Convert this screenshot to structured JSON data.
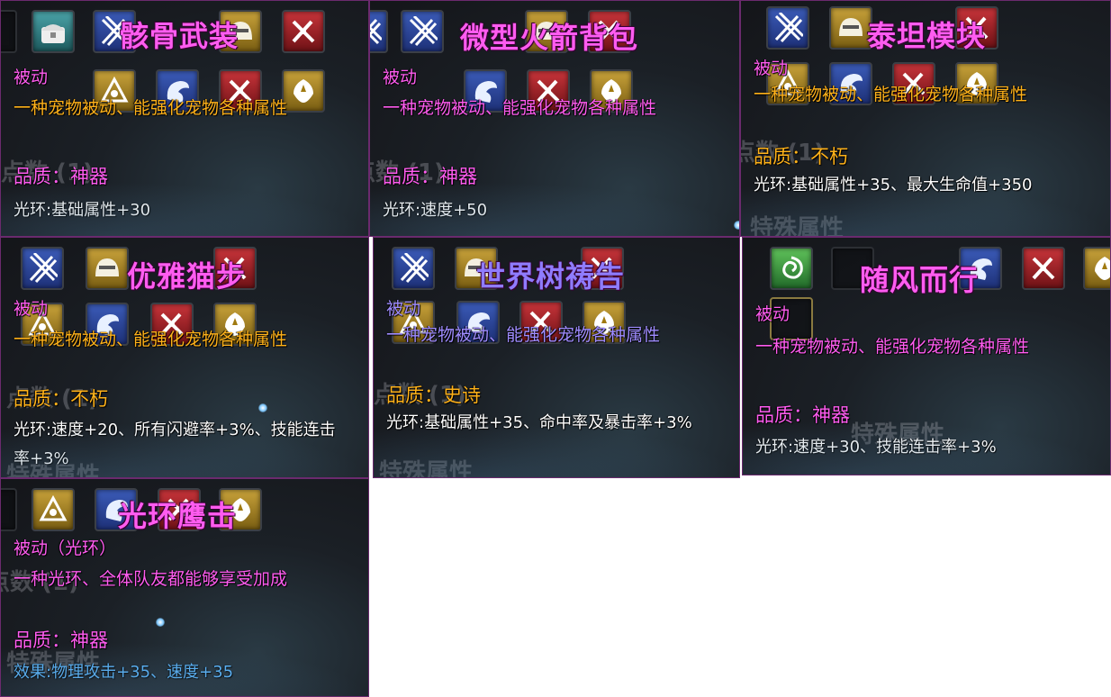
{
  "cards": [
    {
      "title": "骸骨武装",
      "passive": "被动",
      "desc": "一种宠物被动、能强化宠物各种属性",
      "quality": "品质：神器",
      "aura": "光环:基础属性+30"
    },
    {
      "title": "微型火箭背包",
      "passive": "被动",
      "desc": "一种宠物被动、能强化宠物各种属性",
      "quality": "品质：神器",
      "aura": "光环:速度+50"
    },
    {
      "title": "泰坦模块",
      "passive": "被动",
      "desc": "一种宠物被动、能强化宠物各种属性",
      "quality": "品质：不朽",
      "aura": "光环:基础属性+35、最大生命值+350"
    },
    {
      "title": "优雅猫步",
      "passive": "被动",
      "desc": "一种宠物被动、能强化宠物各种属性",
      "quality": "品质：不朽",
      "aura": "光环:速度+20、所有闪避率+3%、技能连击率+3%"
    },
    {
      "title": "世界树祷告",
      "passive": "被动",
      "desc": "一种宠物被动、能强化宠物各种属性",
      "quality": "品质：史诗",
      "aura": "光环:基础属性+35、命中率及暴击率+3%"
    },
    {
      "title": "随风而行",
      "passive": "被动",
      "desc": "一种宠物被动、能强化宠物各种属性",
      "quality": "品质：神器",
      "aura": "光环:速度+30、技能连击率+3%"
    },
    {
      "title": "光环鹰击",
      "passive": "被动（光环）",
      "desc": "一种光环、全体队友都能够享受加成",
      "quality": "品质：神器",
      "aura": "效果:物理攻击+35、速度+35"
    }
  ],
  "background_text": {
    "points": "点数 (1)",
    "special": "特殊属性"
  },
  "icon_names": [
    "claw-icon",
    "chest-icon",
    "helmet-icon",
    "sword-icon",
    "triforce-icon",
    "dragon-icon",
    "crest-icon",
    "swirl-icon"
  ],
  "colors": {
    "title": "#ff5cf0",
    "orange_text": "#ffb21a",
    "violet_text": "#9f8cff",
    "aura_blue": "#5db8ff",
    "border": "#6b2a6e"
  }
}
